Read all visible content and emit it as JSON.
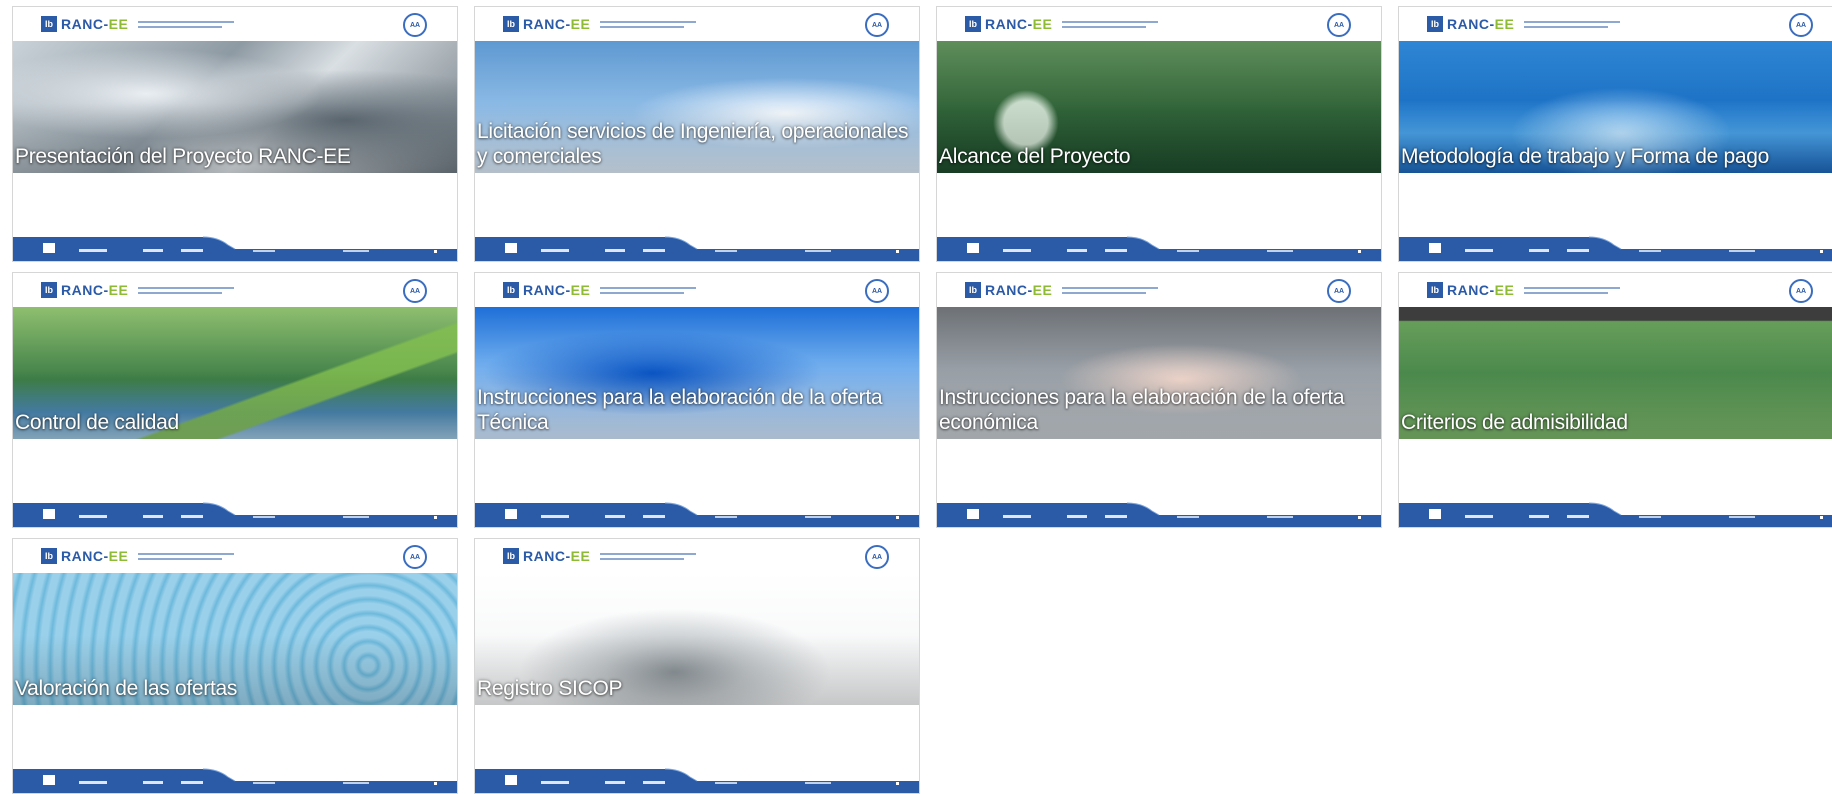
{
  "branding": {
    "logo_icon": "Ib",
    "logo_name": "RANC-",
    "logo_name_suffix": "EE",
    "badge_text": "AA",
    "primary_color": "#2b5aa6",
    "accent_color": "#8dbb33"
  },
  "slides": [
    {
      "title": "Presentación del Proyecto RANC-EE",
      "banner": "water-surface"
    },
    {
      "title": "Licitación servicios de Ingeniería, operacionales y comerciales",
      "banner": "glass-pour"
    },
    {
      "title": "Alcance del Proyecto",
      "banner": "green-droplet"
    },
    {
      "title": "Metodología de trabajo y Forma de pago",
      "banner": "blue-drop"
    },
    {
      "title": "Control de calidad",
      "banner": "leaf-drop"
    },
    {
      "title": "Instrucciones para la elaboración de la oferta Técnica",
      "banner": "water-splash"
    },
    {
      "title": "Instrucciones para la elaboración de la oferta económica",
      "banner": "hands-water"
    },
    {
      "title": "Criterios de admisibilidad",
      "banner": "rain-green"
    },
    {
      "title": "Valoración de las ofertas",
      "banner": "ripples"
    },
    {
      "title": "Registro SICOP",
      "banner": "white-splash"
    }
  ]
}
